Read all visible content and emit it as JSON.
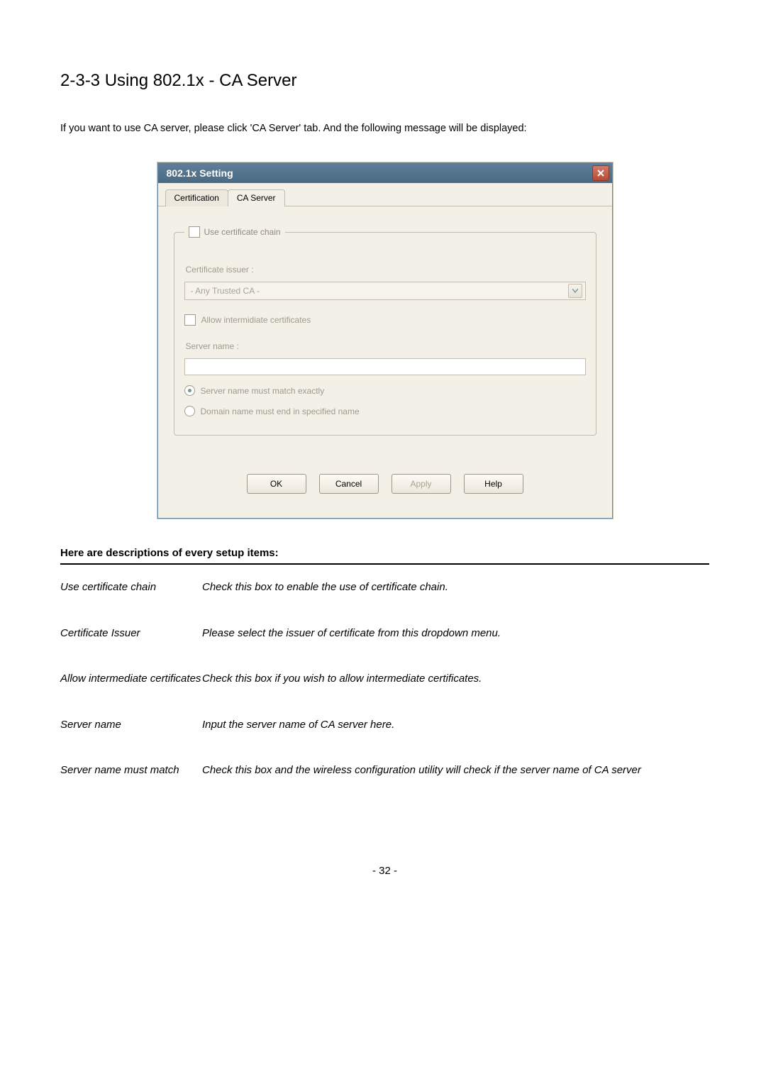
{
  "section": {
    "heading": "2-3-3 Using 802.1x - CA Server",
    "intro": "If you want to use CA server, please click 'CA Server' tab. And the following message will be displayed:"
  },
  "dialog": {
    "title": "802.1x Setting",
    "tabs": {
      "certification": "Certification",
      "ca_server": "CA Server"
    },
    "group_legend": "Use certificate chain",
    "issuer_label": "Certificate issuer :",
    "issuer_value": "- Any Trusted CA -",
    "allow_intermediate": "Allow intermidiate certificates",
    "server_name_label": "Server name :",
    "radio_exact": "Server name must match exactly",
    "radio_domain": "Domain name must end in specified name",
    "buttons": {
      "ok": "OK",
      "cancel": "Cancel",
      "apply": "Apply",
      "help": "Help"
    }
  },
  "descriptions_heading": "Here are descriptions of every setup items:",
  "descriptions": {
    "use_cert_chain": {
      "label": "Use certificate chain",
      "text": "Check this box to enable the use of certificate chain."
    },
    "cert_issuer": {
      "label": "Certificate Issuer",
      "text": "Please select the issuer of certificate from this dropdown menu."
    },
    "allow_inter": {
      "label": "Allow intermediate certificates",
      "text": "Check this box if you wish to allow intermediate certificates."
    },
    "server_name": {
      "label": "Server name",
      "text": "Input the server name of CA server here."
    },
    "server_match": {
      "label": "Server name must match",
      "text": "Check this box and the wireless configuration utility will check if the server name of CA server"
    }
  },
  "page_number": "- 32 -"
}
